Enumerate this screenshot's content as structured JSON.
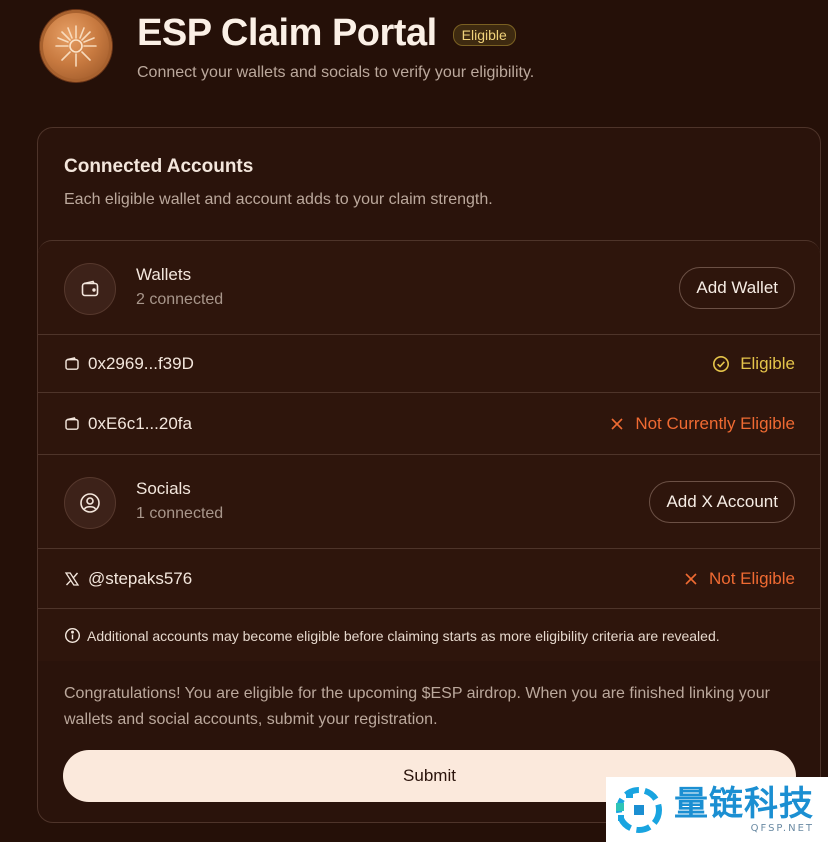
{
  "header": {
    "title": "ESP Claim Portal",
    "badge": "Eligible",
    "subtitle": "Connect your wallets and socials to verify your eligibility."
  },
  "card": {
    "title": "Connected Accounts",
    "subtitle": "Each eligible wallet and account adds to your claim strength."
  },
  "wallets": {
    "title": "Wallets",
    "count": "2 connected",
    "add_label": "Add Wallet",
    "items": [
      {
        "address": "0x2969...f39D",
        "status": "Eligible",
        "status_icon": "check-circle-icon",
        "status_color": "#e5c44a"
      },
      {
        "address": "0xE6c1...20fa",
        "status": "Not Currently Eligible",
        "status_icon": "x-icon",
        "status_color": "#ef6a32"
      }
    ]
  },
  "socials": {
    "title": "Socials",
    "count": "1 connected",
    "add_label": "Add X Account",
    "items": [
      {
        "handle": "@stepaks576",
        "status": "Not Eligible",
        "status_icon": "x-icon",
        "status_color": "#ef6a32"
      }
    ]
  },
  "info_note": "Additional accounts may become eligible before claiming starts as more eligibility criteria are revealed.",
  "congrats": "Congratulations! You are eligible for the upcoming $ESP airdrop. When you are finished linking your wallets and social accounts, submit your registration.",
  "submit_label": "Submit",
  "watermark": {
    "cn": "量链科技",
    "en": "QFSP.NET"
  },
  "colors": {
    "background": "#251008",
    "accent_eligible": "#e5c44a",
    "accent_not_eligible": "#ef6a32",
    "submit_bg": "#fbe9dc"
  }
}
